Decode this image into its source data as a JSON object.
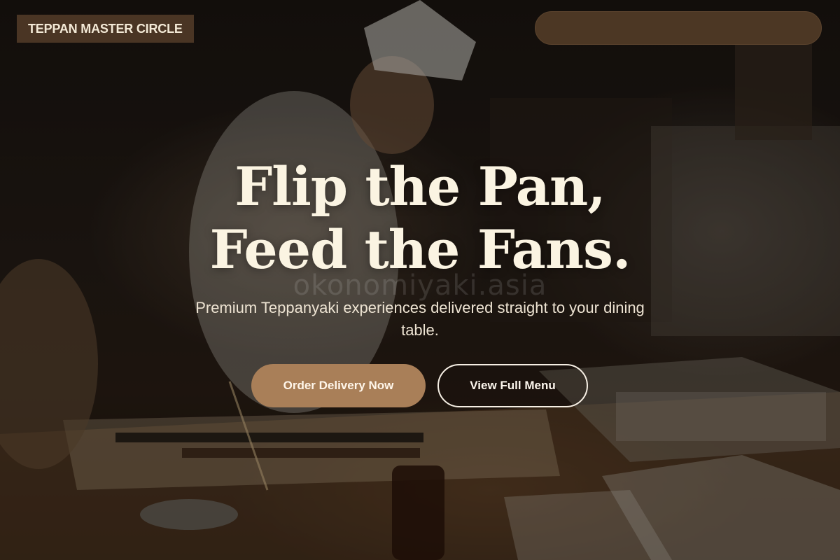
{
  "header": {
    "brand": "TEPPAN MASTER CIRCLE"
  },
  "hero": {
    "headline_line1": "Flip the Pan,",
    "headline_line2": "Feed the Fans.",
    "subtitle": "Premium Teppanyaki experiences delivered straight to your dining table.",
    "watermark": "okonomiyaki.asia",
    "primary_cta": "Order Delivery Now",
    "secondary_cta": "View Full Menu",
    "background_image": "chef-preparing-food-at-counter"
  },
  "colors": {
    "brand_bg": "#4a3524",
    "nav_bg": "#4c3724",
    "primary_button": "#a97f58",
    "headline_text": "#fbf4e2"
  }
}
